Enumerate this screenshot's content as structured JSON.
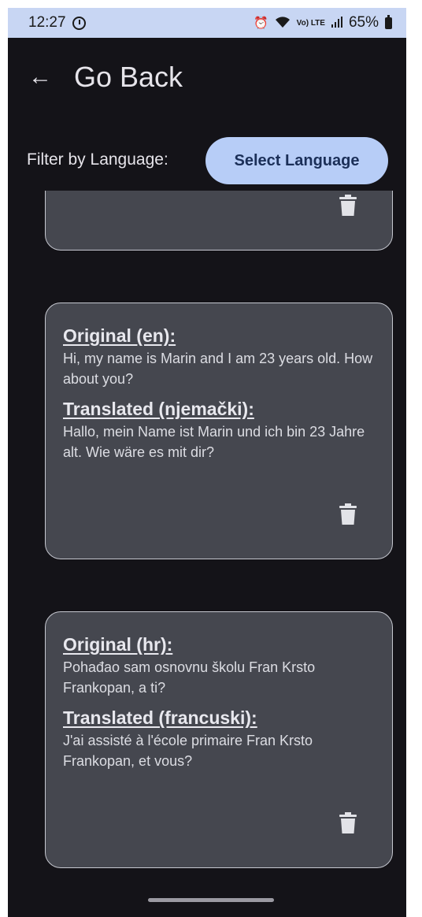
{
  "status_bar": {
    "time": "12:27",
    "network_label": "Vo) LTE",
    "battery_percent": "65%",
    "icons": [
      "sync-icon",
      "alarm-icon",
      "wifi-icon",
      "signal-icon",
      "battery-icon"
    ]
  },
  "header": {
    "back_icon": "←",
    "title": "Go Back"
  },
  "filter": {
    "label": "Filter by Language:",
    "button_label": "Select Language"
  },
  "translations": [
    {
      "original_heading": "",
      "original_text": "",
      "translated_heading": "",
      "translated_text": ""
    },
    {
      "original_heading": "Original (en):",
      "original_text": "Hi, my name is Marin and I am 23 years old. How about you?",
      "translated_heading": "Translated (njemački):",
      "translated_text": "Hallo, mein Name ist Marin und ich bin 23 Jahre alt. Wie wäre es mit dir?"
    },
    {
      "original_heading": "Original (hr):",
      "original_text": "Pohađao sam osnovnu školu Fran Krsto Frankopan, a ti?",
      "translated_heading": "Translated (francuski):",
      "translated_text": "J'ai assisté à l'école primaire Fran Krsto Frankopan, et vous?"
    }
  ],
  "colors": {
    "background": "#141318",
    "card": "#45474f",
    "card_border": "#c6c8d0",
    "button": "#b7cdf7",
    "button_text": "#1b2f58",
    "status_bar": "#c8d6f3"
  }
}
